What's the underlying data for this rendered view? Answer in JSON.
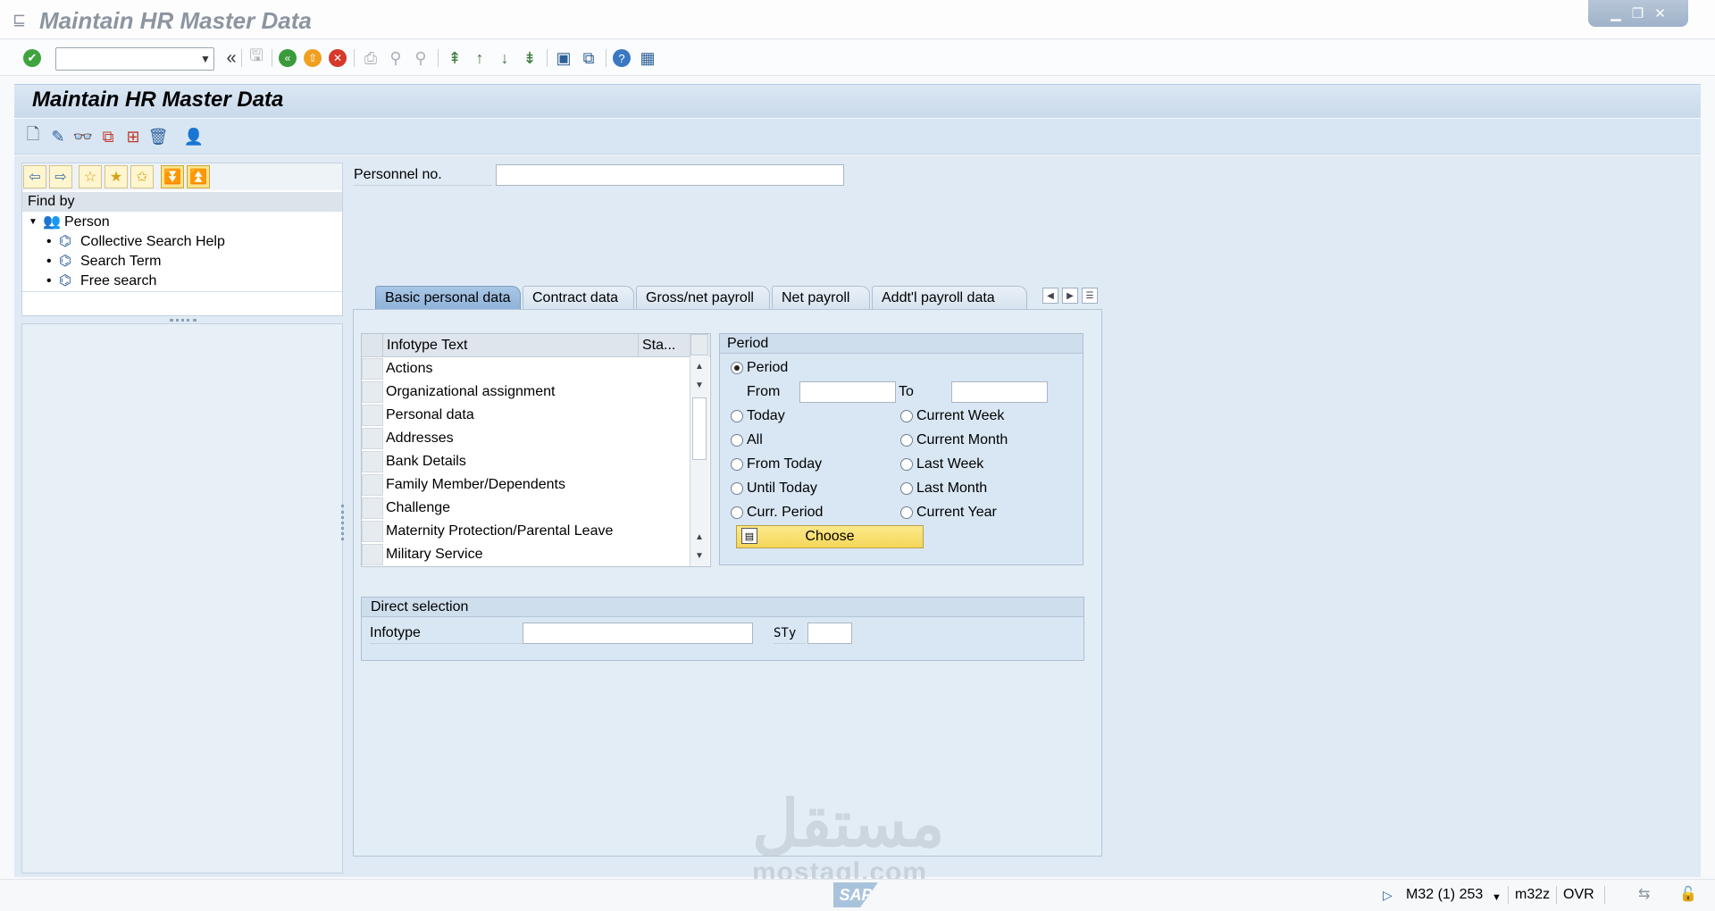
{
  "window": {
    "title": "Maintain HR Master Data"
  },
  "screen": {
    "title": "Maintain HR Master Data"
  },
  "nav": {
    "find_by": "Find by",
    "person": "Person",
    "items": [
      "Collective Search Help",
      "Search Term",
      "Free search"
    ]
  },
  "personnel": {
    "label": "Personnel no.",
    "value": ""
  },
  "tabs": [
    "Basic personal data",
    "Contract data",
    "Gross/net payroll",
    "Net payroll",
    "Addt'l payroll data"
  ],
  "infotype_table": {
    "col_text": "Infotype Text",
    "col_status": "Sta...",
    "rows": [
      "Actions",
      "Organizational assignment",
      "Personal data",
      "Addresses",
      "Bank Details",
      "Family Member/Dependents",
      "Challenge",
      "Maternity Protection/Parental Leave",
      "Military Service"
    ]
  },
  "period": {
    "title": "Period",
    "period_radio": "Period",
    "from_label": "From",
    "to_label": "To",
    "from_value": "",
    "to_value": "",
    "options_left": [
      "Today",
      "All",
      "From Today",
      "Until Today",
      "Curr. Period"
    ],
    "options_right": [
      "Current Week",
      "Current Month",
      "Last Week",
      "Last Month",
      "Current Year"
    ],
    "choose": "Choose"
  },
  "direct_selection": {
    "title": "Direct selection",
    "infotype_label": "Infotype",
    "infotype_value": "",
    "sty_label": "STy",
    "sty_value": ""
  },
  "watermark": {
    "arabic": "مستقل",
    "latin": "mostaql.com",
    "sap": "SAP"
  },
  "status": {
    "session": "M32 (1) 253",
    "client": "m32z",
    "mode": "OVR"
  }
}
